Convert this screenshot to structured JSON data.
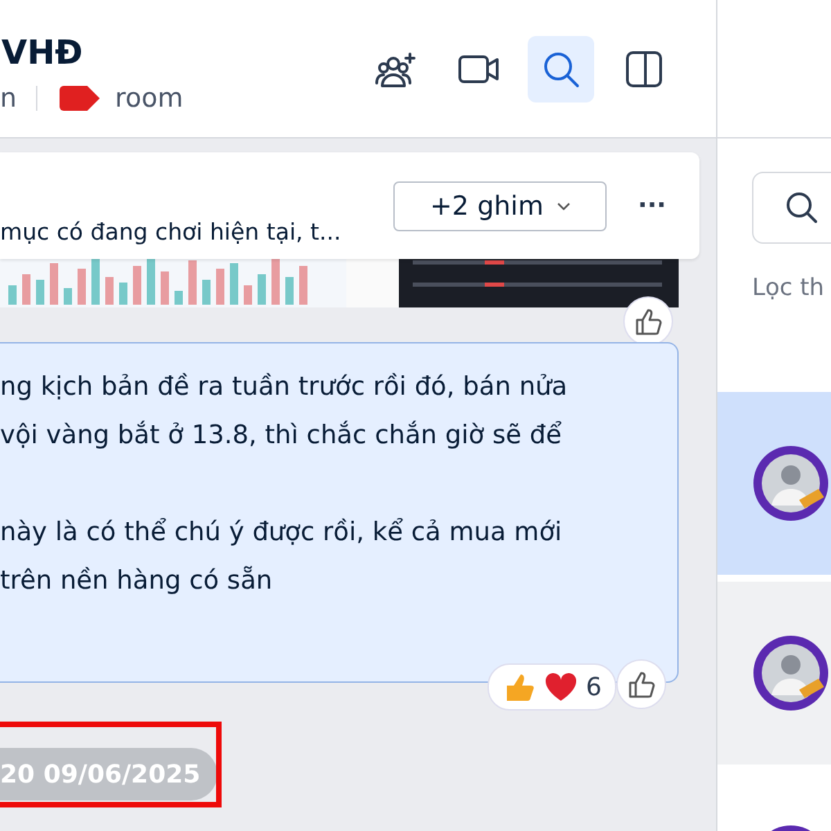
{
  "header": {
    "title": "VHĐ",
    "subtitle": "n",
    "tag": {
      "label": "room",
      "color": "#e02020"
    },
    "buttons": [
      {
        "kind": "add-member",
        "active": false
      },
      {
        "kind": "video",
        "active": false
      },
      {
        "kind": "search",
        "active": true
      },
      {
        "kind": "panel",
        "active": false
      }
    ]
  },
  "pinned": {
    "text": "mục có đang chơi hiện tại, t...",
    "more_pins": "+2 ghim",
    "menu": "···"
  },
  "message": {
    "paragraphs": [
      [
        "ng kịch bản đề ra tuần trước rồi đó, bán nửa",
        "vội vàng bắt ở 13.8, thì chắc chắn giờ sẽ để"
      ],
      [
        "này là có thể chú ý được rồi, kể cả mua mới",
        "trên nền hàng có sẵn"
      ]
    ],
    "reaction_count": "6"
  },
  "timestamp": {
    "text": "20 09/06/2025",
    "highlighted": true
  },
  "side_panel": {
    "filter_label": "Lọc th",
    "conversations": [
      {
        "selected": true,
        "hovered": false
      },
      {
        "selected": false,
        "hovered": true
      },
      {
        "selected": false,
        "hovered": false
      }
    ]
  }
}
